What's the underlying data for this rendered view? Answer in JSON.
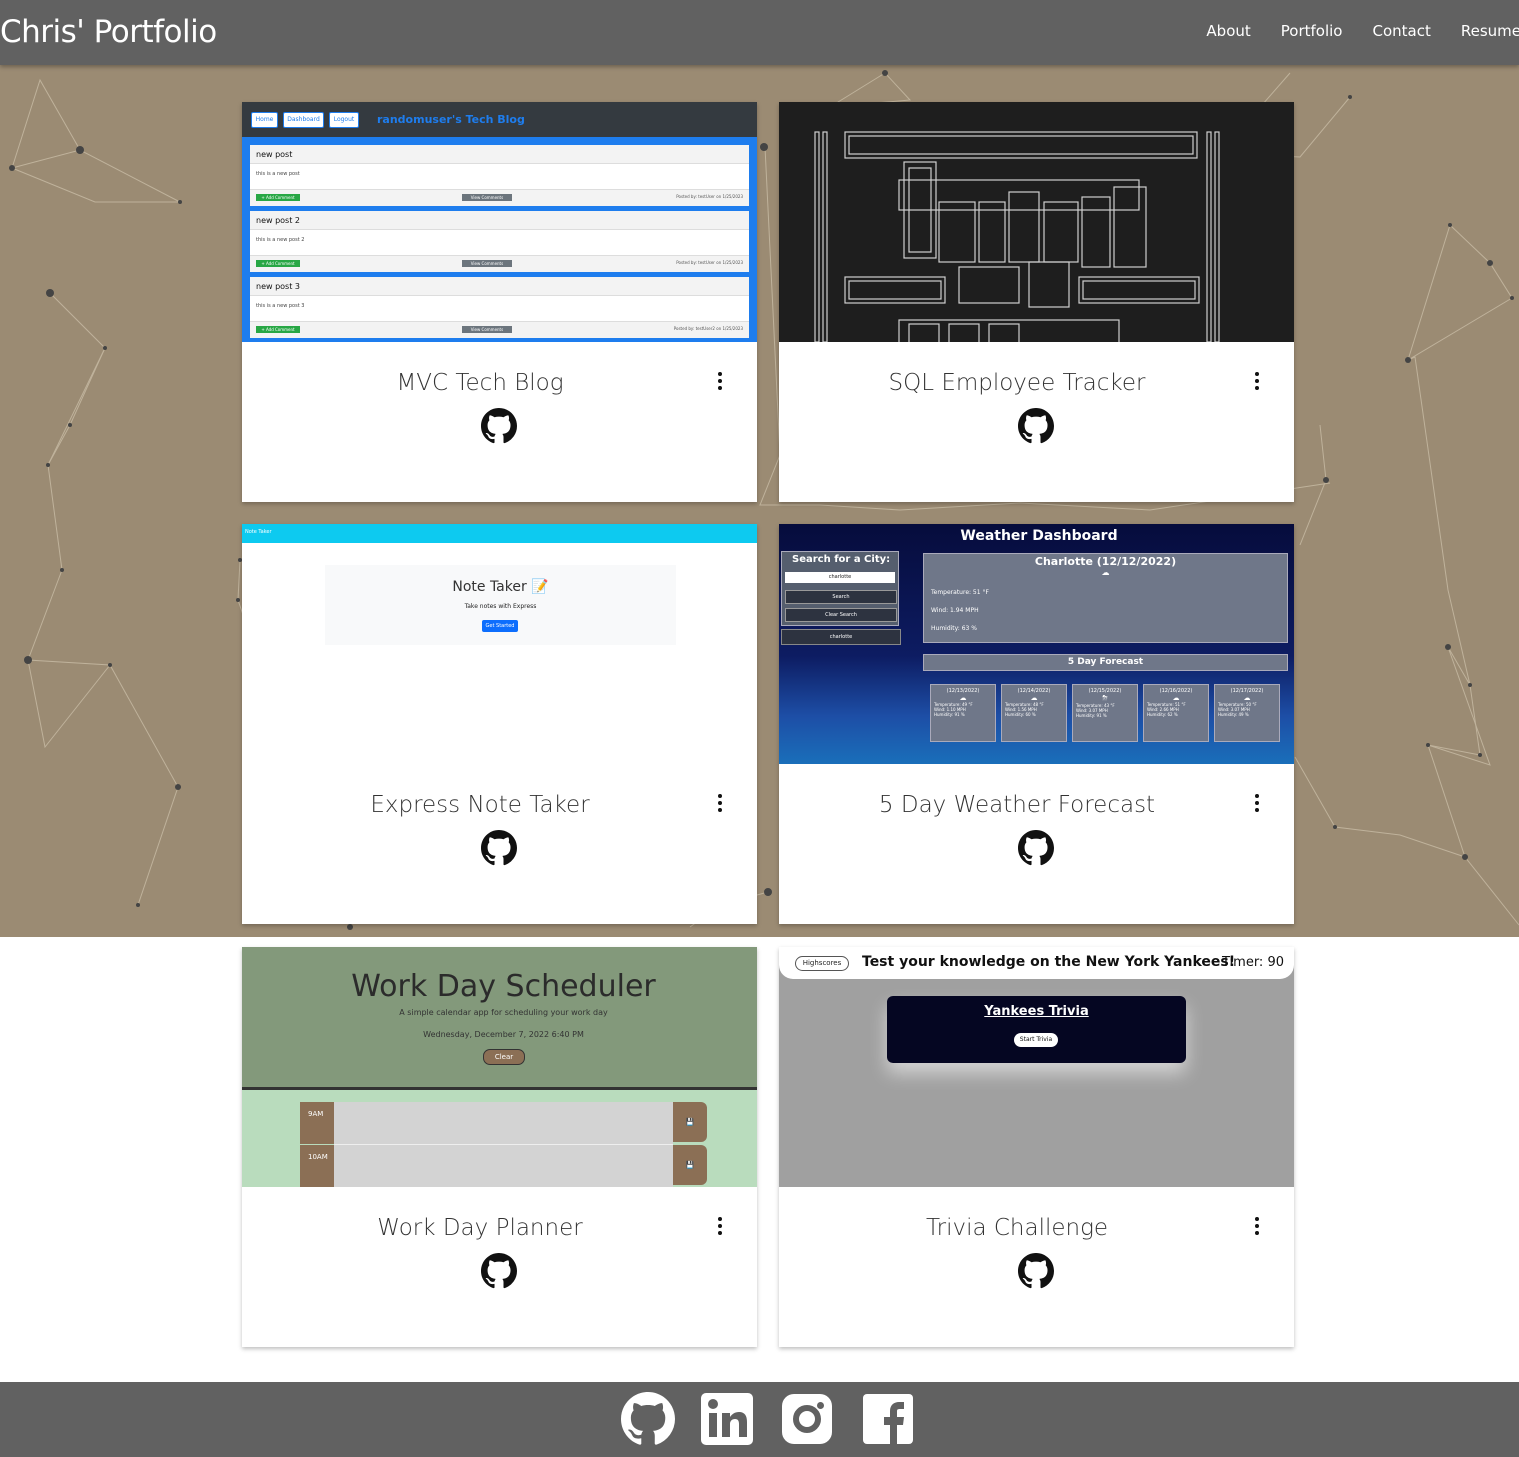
{
  "header": {
    "brand": "Chris' Portfolio",
    "nav": [
      "About",
      "Portfolio",
      "Contact",
      "Resume"
    ]
  },
  "colors": {
    "header_bg": "#616161",
    "hero_bg": "#9b8b73",
    "footer_bg": "#616161",
    "card_bg": "#ffffff"
  },
  "projects": [
    {
      "title": "MVC Tech Blog",
      "link_icon": "github-icon",
      "menu_icon": "kebab-menu-icon",
      "thumbnail": {
        "nav": [
          "Home",
          "Dashboard",
          "Logout"
        ],
        "heading": "randomuser's Tech Blog",
        "posts": [
          {
            "title": "new post",
            "body": "this is a new post",
            "add": "+ Add Comment",
            "view": "View Comments",
            "meta": "Posted by: testUser on 1/25/2023"
          },
          {
            "title": "new post 2",
            "body": "this is a new post 2",
            "add": "+ Add Comment",
            "view": "View Comments",
            "meta": "Posted by: testUser on 1/25/2023"
          },
          {
            "title": "new post 3",
            "body": "this is a new post 3",
            "add": "+ Add Comment",
            "view": "View Comments",
            "meta": "Posted by: testUser2 on 1/25/2023"
          }
        ]
      }
    },
    {
      "title": "SQL Employee Tracker",
      "link_icon": "github-icon",
      "menu_icon": "kebab-menu-icon",
      "thumbnail": {
        "art": "Employee Tracker ascii banner"
      }
    },
    {
      "title": "Express Note Taker",
      "link_icon": "github-icon",
      "menu_icon": "kebab-menu-icon",
      "thumbnail": {
        "bar": "Note Taker",
        "heading": "Note Taker",
        "sub": "Take notes with Express",
        "button": "Get Started"
      }
    },
    {
      "title": "5 Day Weather Forecast",
      "link_icon": "github-icon",
      "menu_icon": "kebab-menu-icon",
      "thumbnail": {
        "heading": "Weather Dashboard",
        "search_label": "Search for a City:",
        "search_value": "charlotte",
        "search_btn": "Search",
        "clear_btn": "Clear Search",
        "history": "charlotte",
        "current_title": "Charlotte (12/12/2022)",
        "temp": "Temperature: 51 °F",
        "wind": "Wind: 1.94 MPH",
        "humidity": "Humidity: 63 %",
        "forecast_title": "5 Day Forecast",
        "days": [
          {
            "date": "(12/13/2022)",
            "temp": "Temperature: 49 °F",
            "wind": "Wind: 1.10 MPH",
            "hum": "Humidity: 91 %"
          },
          {
            "date": "(12/14/2022)",
            "temp": "Temperature: 48 °F",
            "wind": "Wind: 1.56 MPH",
            "hum": "Humidity: 60 %"
          },
          {
            "date": "(12/15/2022)",
            "temp": "Temperature: 43 °F",
            "wind": "Wind: 3.07 MPH",
            "hum": "Humidity: 91 %"
          },
          {
            "date": "(12/16/2022)",
            "temp": "Temperature: 51 °F",
            "wind": "Wind: 2.66 MPH",
            "hum": "Humidity: 62 %"
          },
          {
            "date": "(12/17/2022)",
            "temp": "Temperature: 50 °F",
            "wind": "Wind: 3.07 MPH",
            "hum": "Humidity: 49 %"
          }
        ]
      }
    },
    {
      "title": "Work Day Planner",
      "link_icon": "github-icon",
      "menu_icon": "kebab-menu-icon",
      "thumbnail": {
        "heading": "Work Day Scheduler",
        "sub": "A simple calendar app for scheduling your work day",
        "date": "Wednesday, December 7, 2022 6:40 PM",
        "clear": "Clear",
        "hours": [
          "9AM",
          "10AM"
        ]
      }
    },
    {
      "title": "Trivia Challenge",
      "link_icon": "github-icon",
      "menu_icon": "kebab-menu-icon",
      "thumbnail": {
        "highscores": "Highscores",
        "question": "Test your knowledge on the New York Yankees!",
        "timer": "Timer: 90",
        "box_title": "Yankees Trivia",
        "start": "Start Trivia"
      }
    }
  ],
  "footer": {
    "icons": [
      "github-icon",
      "linkedin-icon",
      "instagram-icon",
      "facebook-icon"
    ]
  }
}
